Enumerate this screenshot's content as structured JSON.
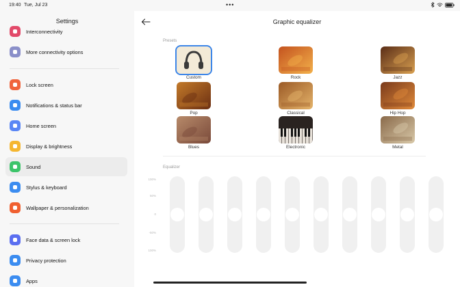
{
  "status": {
    "time": "19:40",
    "date": "Tue, Jul 23"
  },
  "settings": {
    "title": "Settings",
    "items": [
      {
        "label": "Interconnectivity",
        "color": "#e24a6a"
      },
      {
        "label": "More connectivity options",
        "color": "#8a8fc9"
      },
      {
        "label": "Lock screen",
        "color": "#f0643c"
      },
      {
        "label": "Notifications & status bar",
        "color": "#3b8cf0"
      },
      {
        "label": "Home screen",
        "color": "#5a86f5"
      },
      {
        "label": "Display & brightness",
        "color": "#f5b630"
      },
      {
        "label": "Sound",
        "color": "#3cc46a"
      },
      {
        "label": "Stylus & keyboard",
        "color": "#3b8cf0"
      },
      {
        "label": "Wallpaper & personalization",
        "color": "#f06030"
      },
      {
        "label": "Face data & screen lock",
        "color": "#5a6ef0"
      },
      {
        "label": "Privacy protection",
        "color": "#3b8cf0"
      },
      {
        "label": "Apps",
        "color": "#3b8cf0"
      }
    ]
  },
  "equalizer": {
    "title": "Graphic equalizer",
    "presets_label": "Presets",
    "presets": [
      "Custom",
      "Rock",
      "Jazz",
      "Pop",
      "Classical",
      "Hip Hop",
      "Blues",
      "Electronic",
      "Metal"
    ],
    "selected_preset": "Custom",
    "equalizer_label": "Equalizer",
    "scale": [
      "100%",
      "50%",
      "0",
      "-50%",
      "100%"
    ],
    "band_levels": [
      0,
      0,
      0,
      0,
      0,
      0,
      0,
      0,
      0,
      0
    ],
    "accent": "#3d86e8"
  }
}
